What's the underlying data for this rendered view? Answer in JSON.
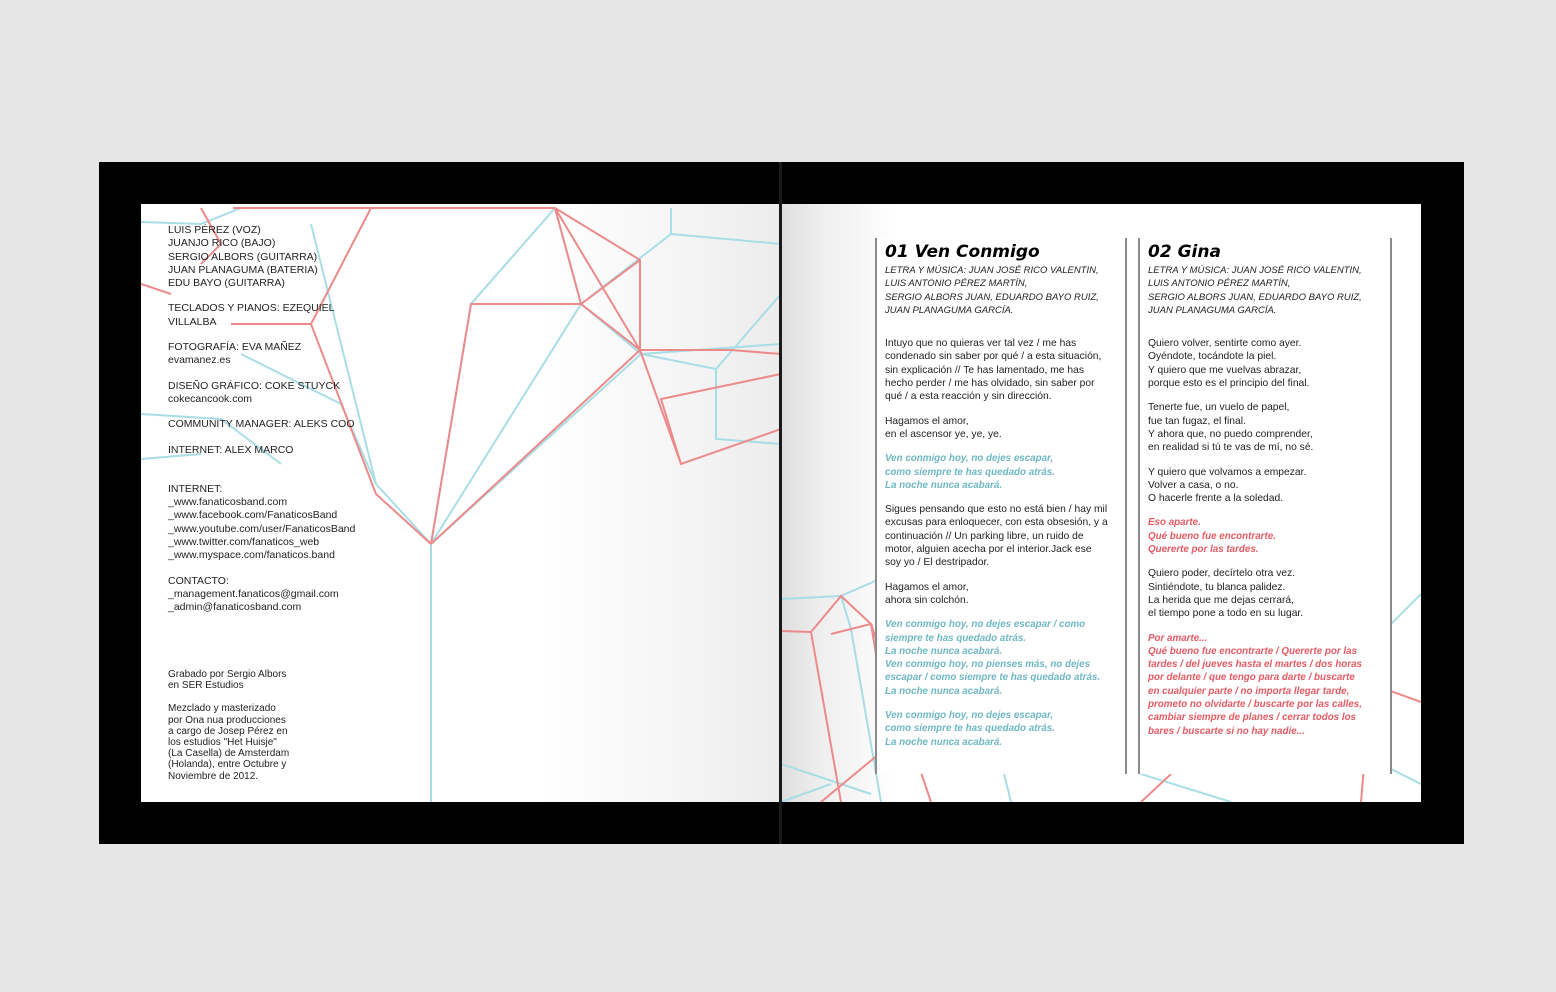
{
  "credits": {
    "band": [
      "LUIS PÉREZ (VOZ)",
      "JUANJO RICO (BAJO)",
      "SERGIO ALBORS (GUITARRA)",
      "JUAN PLANAGUMA (BATERIA)",
      "EDU BAYO (GUITARRA)"
    ],
    "keys": [
      "TECLADOS Y PIANOS: EZEQUIEL",
      "VILLALBA"
    ],
    "photo": [
      "FOTOGRAFÍA: EVA MAÑEZ",
      "evamanez.es"
    ],
    "design": [
      "DISEÑO GRÁFICO: COKE STUYCK",
      "cokecancook.com"
    ],
    "community": [
      "COMMUNITY MANAGER: ALEKS COO"
    ],
    "internet_staff": [
      "INTERNET: ALEX MARCO"
    ],
    "internet": [
      "INTERNET:",
      "_www.fanaticosband.com",
      "_www.facebook.com/FanaticosBand",
      "_www.youtube.com/user/FanaticosBand",
      "_www.twitter.com/fanaticos_web",
      "_www.myspace.com/fanaticos.band"
    ],
    "contact": [
      "CONTACTO:",
      "_management.fanaticos@gmail.com",
      "_admin@fanaticosband.com"
    ]
  },
  "recording": {
    "recorded": [
      "Grabado por Sergio Albors",
      "en SER Estudios"
    ],
    "mixed": [
      "Mezclado y masterizado",
      "por Ona nua producciones",
      "a cargo de Josep Pérez en",
      "los estudios \"Het Huisje\"",
      "(La Casella) de Amsterdam",
      "(Holanda), entre Octubre y",
      "Noviembre de 2012."
    ]
  },
  "songs": [
    {
      "title": "01 Ven Conmigo",
      "credits": [
        "LETRA Y MÚSICA: JUAN JOSÉ RICO VALENTIN,",
        "LUIS ANTONIO PÉREZ MARTÍN,",
        "SERGIO ALBORS JUAN, EDUARDO BAYO RUIZ,",
        "JUAN PLANAGUMA GARCÍA."
      ],
      "verses": [
        {
          "style": "normal",
          "lines": [
            "Intuyo que no quieras ver tal vez / me has",
            "condenado sin saber por qué / a esta situación,",
            "sin explicación // Te has lamentado, me has",
            "hecho perder / me has olvidado, sin saber por",
            "qué / a esta reacción y sin dirección."
          ]
        },
        {
          "style": "normal",
          "lines": [
            "Hagamos el amor,",
            "en el ascensor ye, ye, ye."
          ]
        },
        {
          "style": "blue",
          "lines": [
            "Ven conmigo hoy, no dejes escapar,",
            "como siempre te has quedado atrás.",
            "La noche nunca acabará."
          ]
        },
        {
          "style": "normal",
          "lines": [
            "Sigues pensando que esto no está bien / hay mil",
            "excusas para enloquecer, con esta obsesión, y a",
            "continuación // Un parking libre, un ruido de",
            "motor, alguien acecha por el interior.Jack ese",
            "soy yo / El destripador."
          ]
        },
        {
          "style": "normal",
          "lines": [
            "Hagamos el amor,",
            "ahora sin colchón."
          ]
        },
        {
          "style": "blue",
          "lines": [
            "Ven conmigo hoy, no dejes escapar / como",
            "siempre te has quedado atrás.",
            "La noche nunca acabará.",
            "Ven conmigo hoy, no pienses más, no dejes",
            "escapar / como siempre te has quedado atrás.",
            "La noche nunca acabará."
          ]
        },
        {
          "style": "blue",
          "lines": [
            "Ven conmigo hoy, no dejes escapar,",
            "como siempre te has quedado atrás.",
            "La noche nunca acabará."
          ]
        }
      ]
    },
    {
      "title": "02 Gina",
      "credits": [
        "LETRA Y MÚSICA: JUAN JOSÉ RICO VALENTIN,",
        "LUIS ANTONIO PÉREZ MARTÍN,",
        "SERGIO ALBORS JUAN, EDUARDO BAYO RUIZ,",
        "JUAN PLANAGUMA GARCÍA."
      ],
      "verses": [
        {
          "style": "normal",
          "lines": [
            "Quiero volver, sentirte como ayer.",
            "Oyéndote, tocándote la piel.",
            "Y quiero que me vuelvas abrazar,",
            "porque esto es el principio del final."
          ]
        },
        {
          "style": "normal",
          "lines": [
            "Tenerte fue, un vuelo de papel,",
            "fue tan fugaz, el final.",
            "Y ahora que, no puedo comprender,",
            "en realidad si tú te vas de mí, no sé."
          ]
        },
        {
          "style": "normal",
          "lines": [
            "Y quiero que volvamos a empezar.",
            "Volver a casa, o no.",
            "O hacerle frente a la soledad."
          ]
        },
        {
          "style": "red",
          "lines": [
            "Eso aparte.",
            "Qué bueno fue encontrarte.",
            "Quererte por las tardes."
          ]
        },
        {
          "style": "normal",
          "lines": [
            "Quiero poder, decírtelo otra vez.",
            "Sintiéndote, tu blanca palidez.",
            "La herida que me dejas cerrará,",
            "el tiempo pone a todo en su lugar."
          ]
        },
        {
          "style": "red",
          "lines": [
            "Por amarte...",
            "Qué bueno fue encontrarte / Quererte  por las",
            "tardes / del jueves hasta el martes / dos horas",
            "por delante / que tengo para darte / buscarte",
            "en cualquier parte / no importa llegar tarde,",
            "prometo no olvidarte / buscarte por las calles,",
            "cambiar siempre de planes / cerrar todos los",
            "bares / buscarte si no hay nadie..."
          ]
        }
      ]
    }
  ],
  "colors": {
    "accent_red": "#e45b63",
    "accent_blue": "#6fb7c2"
  }
}
